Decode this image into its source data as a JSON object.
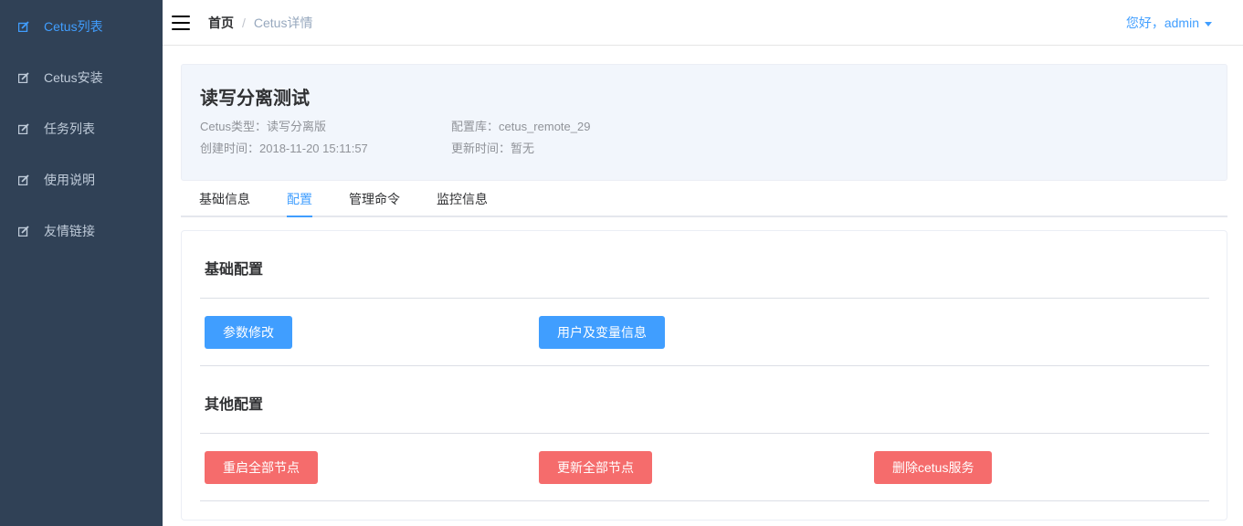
{
  "sidebar": {
    "items": [
      {
        "label": "Cetus列表",
        "icon": "edit-icon",
        "active": true
      },
      {
        "label": "Cetus安装",
        "icon": "edit-icon",
        "active": false
      },
      {
        "label": "任务列表",
        "icon": "edit-icon",
        "active": false
      },
      {
        "label": "使用说明",
        "icon": "edit-icon",
        "active": false
      },
      {
        "label": "友情链接",
        "icon": "edit-icon",
        "active": false
      }
    ]
  },
  "navbar": {
    "breadcrumb": {
      "home": "首页",
      "separator": "/",
      "current": "Cetus详情"
    },
    "user_greeting": "您好，admin"
  },
  "header": {
    "title": "读写分离测试",
    "type": "Cetus类型：读写分离版",
    "config_db": "配置库：cetus_remote_29",
    "created": "创建时间：2018-11-20 15:11:57",
    "updated": "更新时间：暂无"
  },
  "tabs": [
    {
      "label": "基础信息",
      "active": false
    },
    {
      "label": "配置",
      "active": true
    },
    {
      "label": "管理命令",
      "active": false
    },
    {
      "label": "监控信息",
      "active": false
    }
  ],
  "config": {
    "basic": {
      "title": "基础配置",
      "buttons": [
        "参数修改",
        "用户及变量信息"
      ]
    },
    "other": {
      "title": "其他配置",
      "buttons": [
        "重启全部节点",
        "更新全部节点",
        "删除cetus服务"
      ]
    }
  },
  "colors": {
    "sidebar_bg": "#304156",
    "accent": "#409eff",
    "danger": "#f56c6c",
    "header_bg": "#f2f6fc"
  }
}
